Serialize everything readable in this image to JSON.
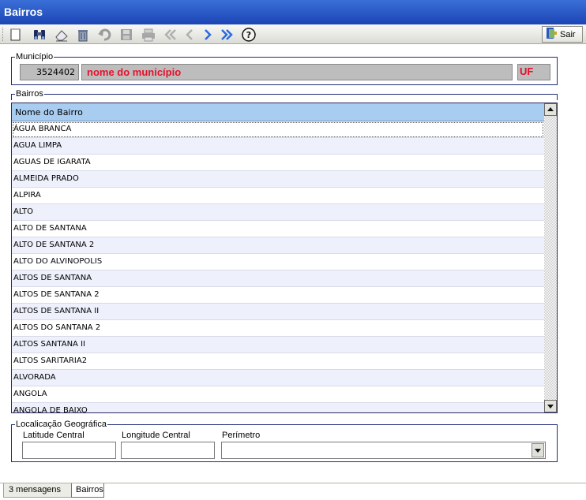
{
  "window": {
    "title": "Bairros"
  },
  "toolbar": {
    "buttons": [
      "new",
      "search",
      "edit",
      "delete",
      "undo",
      "save",
      "print",
      "first",
      "previous",
      "next",
      "last",
      "help"
    ],
    "exit_label": "Sair"
  },
  "municipio": {
    "legend": "Município",
    "code": "3524402",
    "name": "nome do município",
    "uf": "UF"
  },
  "bairros": {
    "legend": "Bairros",
    "column_header": "Nome do Bairro",
    "rows": [
      "ÁGUA BRANCA",
      "AGUA LIMPA",
      "AGUAS DE IGARATA",
      "ALMEIDA PRADO",
      "ALPIRA",
      "ALTO",
      "ALTO DE SANTANA",
      "ALTO DE SANTANA 2",
      "ALTO DO ALVINOPOLIS",
      "ALTOS DE SANTANA",
      "ALTOS DE SANTANA 2",
      "ALTOS DE SANTANA II",
      "ALTOS DO SANTANA 2",
      "ALTOS SANTANA II",
      "ALTOS SARITARIA2",
      "ALVORADA",
      "ANGOLA",
      "ANGOLA DE BAIXO"
    ]
  },
  "geo": {
    "legend": "Localicação Geográfica",
    "latitude_label": "Latitude Central",
    "longitude_label": "Longitude Central",
    "perimetro_label": "Perímetro",
    "latitude_value": "",
    "longitude_value": "",
    "perimetro_value": ""
  },
  "tabs": [
    {
      "label": "3 mensagens",
      "active": false
    },
    {
      "label": "Bairros",
      "active": true
    }
  ],
  "colors": {
    "titlebar": "#2456c8",
    "grid_header": "#a9cdf1",
    "alt_row": "#eef0fb",
    "highlight_text": "#e8102a"
  }
}
